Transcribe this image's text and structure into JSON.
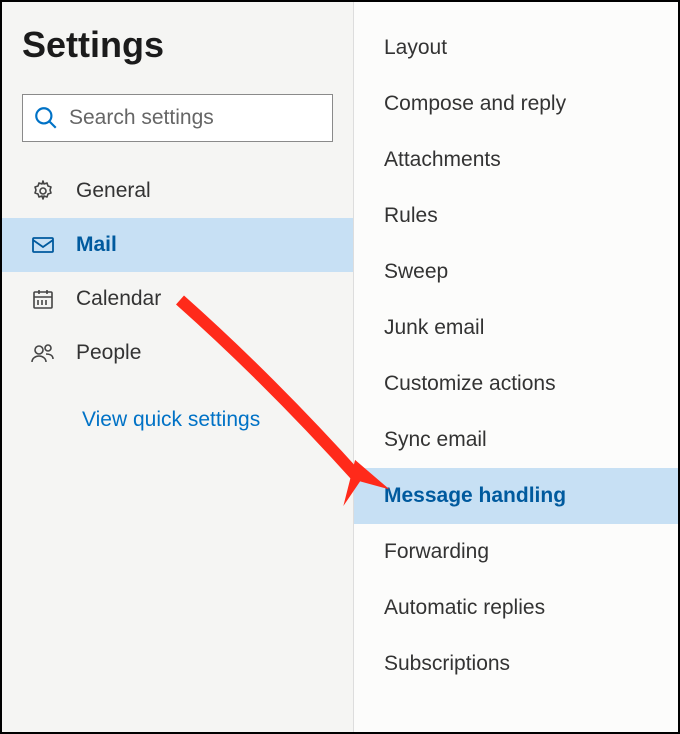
{
  "header": {
    "title": "Settings"
  },
  "search": {
    "placeholder": "Search settings"
  },
  "sidebar": {
    "items": [
      {
        "label": "General",
        "icon": "gear-icon",
        "selected": false
      },
      {
        "label": "Mail",
        "icon": "mail-icon",
        "selected": true
      },
      {
        "label": "Calendar",
        "icon": "calendar-icon",
        "selected": false
      },
      {
        "label": "People",
        "icon": "people-icon",
        "selected": false
      }
    ],
    "quick_link": "View quick settings"
  },
  "subpanel": {
    "items": [
      {
        "label": "Layout",
        "selected": false
      },
      {
        "label": "Compose and reply",
        "selected": false
      },
      {
        "label": "Attachments",
        "selected": false
      },
      {
        "label": "Rules",
        "selected": false
      },
      {
        "label": "Sweep",
        "selected": false
      },
      {
        "label": "Junk email",
        "selected": false
      },
      {
        "label": "Customize actions",
        "selected": false
      },
      {
        "label": "Sync email",
        "selected": false
      },
      {
        "label": "Message handling",
        "selected": true
      },
      {
        "label": "Forwarding",
        "selected": false
      },
      {
        "label": "Automatic replies",
        "selected": false
      },
      {
        "label": "Subscriptions",
        "selected": false
      }
    ]
  },
  "annotation": {
    "type": "arrow",
    "color": "#ff2a1a"
  }
}
